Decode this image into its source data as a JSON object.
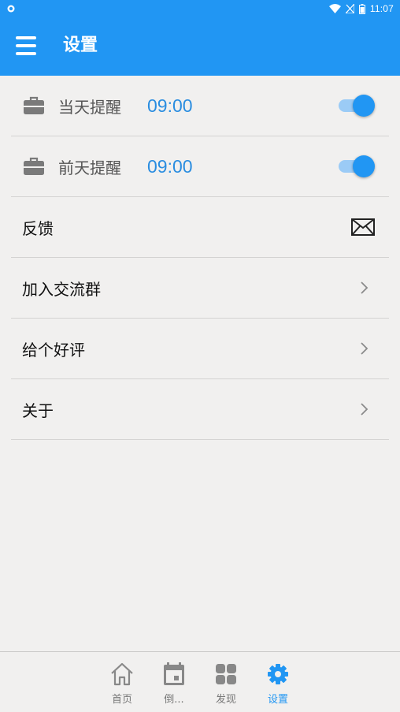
{
  "status_bar": {
    "time": "11:07"
  },
  "app_bar": {
    "title": "设置"
  },
  "reminders": [
    {
      "label": "当天提醒",
      "time": "09:00",
      "enabled": true
    },
    {
      "label": "前天提醒",
      "time": "09:00",
      "enabled": true
    }
  ],
  "menu_rows": [
    {
      "label": "反馈",
      "trailing_icon": "mail-icon"
    },
    {
      "label": "加入交流群",
      "trailing_icon": "chevron-right-icon"
    },
    {
      "label": "给个好评",
      "trailing_icon": "chevron-right-icon"
    },
    {
      "label": "关于",
      "trailing_icon": "chevron-right-icon"
    }
  ],
  "bottom_nav": [
    {
      "label": "首页",
      "icon": "home-icon",
      "active": false
    },
    {
      "label": "倒...",
      "icon": "calendar-icon",
      "active": false
    },
    {
      "label": "发现",
      "icon": "grid-icon",
      "active": false
    },
    {
      "label": "设置",
      "icon": "gear-icon",
      "active": true
    }
  ],
  "colors": {
    "accent": "#2196f3",
    "toggle_track": "#9bcbf6",
    "time_text": "#2a8de0",
    "background": "#f1f0ef"
  }
}
